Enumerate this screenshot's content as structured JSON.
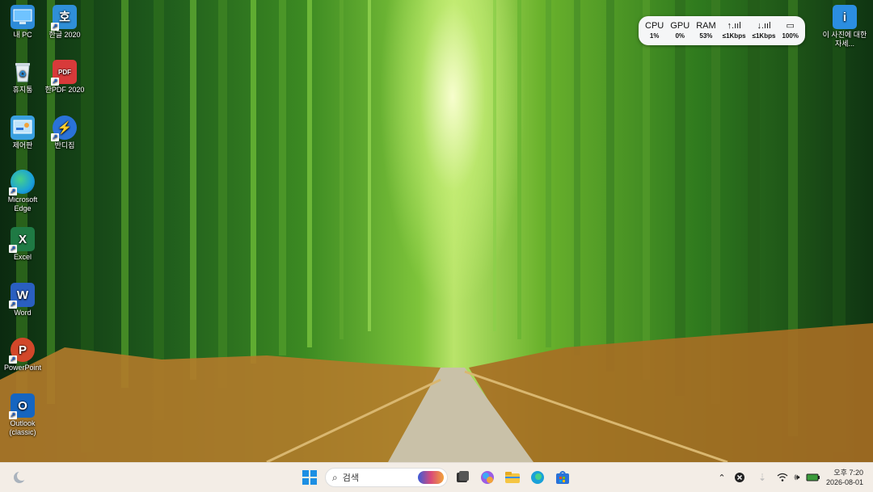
{
  "desktop": {
    "icons_left": [
      {
        "label": "내 PC",
        "icon": "computer-icon",
        "color": "#2d8bd8"
      },
      {
        "label": "휴지통",
        "icon": "recycle-bin-icon",
        "color": "#e8eef2"
      },
      {
        "label": "제어판",
        "icon": "control-panel-icon",
        "color": "#3aa0e0"
      },
      {
        "label": "Microsoft Edge",
        "icon": "edge-icon",
        "color": "#1aa1d8"
      },
      {
        "label": "Excel",
        "icon": "excel-icon",
        "color": "#1f7a44"
      },
      {
        "label": "Word",
        "icon": "word-icon",
        "color": "#2a5fc0"
      },
      {
        "label": "PowerPoint",
        "icon": "powerpoint-icon",
        "color": "#d2472a"
      },
      {
        "label": "Outlook (classic)",
        "icon": "outlook-icon",
        "color": "#1565c0"
      }
    ],
    "icons_second": [
      {
        "label": "한글 2020",
        "glyph": "호",
        "icon": "hangul-icon",
        "color": "#2f8fd8"
      },
      {
        "label": "한PDF 2020",
        "glyph": "PDF",
        "icon": "hanpdf-icon",
        "color": "#d83a3a"
      },
      {
        "label": "반디집",
        "glyph": "⚡",
        "icon": "bandizip-icon",
        "color": "#2a72d8"
      }
    ],
    "icon_right": {
      "label": "이 사진에 대한 자세...",
      "glyph": "i",
      "icon": "image-info-icon",
      "color": "#2b8ee0"
    },
    "glyphs": {
      "excel": "X",
      "word": "W",
      "powerpoint": "P",
      "outlook": "O"
    }
  },
  "monitor": {
    "columns": [
      {
        "head": "CPU",
        "value": "1%"
      },
      {
        "head": "GPU",
        "value": "0%"
      },
      {
        "head": "RAM",
        "value": "53%"
      },
      {
        "head": "↑.ııl",
        "value": "≤1Kbps"
      },
      {
        "head": "↓.ııl",
        "value": "≤1Kbps"
      },
      {
        "head": "▭",
        "value": "100%"
      }
    ]
  },
  "taskbar": {
    "search_placeholder": "검색",
    "clock_time": "오후 7:20",
    "clock_date": "2026-08-01",
    "apps": [
      "start-icon",
      "file-manager-icon",
      "copilot-icon",
      "file-explorer-icon",
      "edge-icon",
      "store-icon"
    ]
  }
}
